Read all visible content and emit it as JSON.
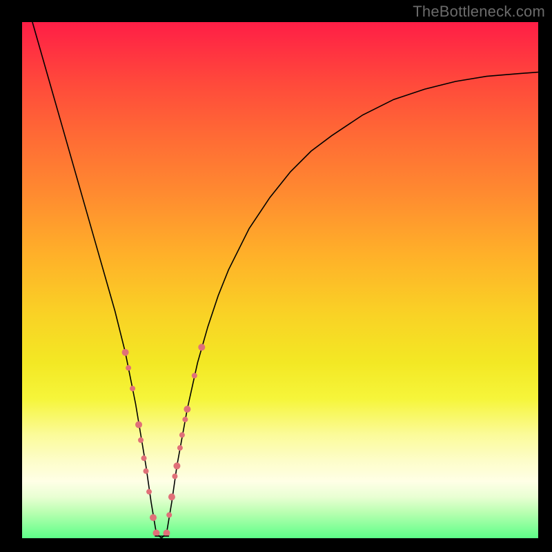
{
  "watermark": "TheBottleneck.com",
  "colors": {
    "gradient_top": "#ff1e46",
    "gradient_bottom": "#5dff88",
    "curve": "#000000",
    "dots": "#e07078",
    "frame": "#000000"
  },
  "chart_data": {
    "type": "line",
    "title": "",
    "xlabel": "",
    "ylabel": "",
    "xlim": [
      0,
      100
    ],
    "ylim": [
      0,
      100
    ],
    "legend": false,
    "grid": false,
    "series": [
      {
        "name": "bottleneck-curve",
        "x": [
          2,
          4,
          6,
          8,
          10,
          12,
          14,
          16,
          18,
          20,
          21,
          22,
          23,
          24,
          25,
          26,
          27,
          28,
          29,
          30,
          32,
          34,
          36,
          38,
          40,
          44,
          48,
          52,
          56,
          60,
          66,
          72,
          78,
          84,
          90,
          96,
          100
        ],
        "y": [
          100,
          93,
          86,
          79,
          72,
          65,
          58,
          51,
          44,
          36,
          31,
          26,
          20,
          14,
          7,
          1,
          0,
          1,
          7,
          14,
          25,
          34,
          41,
          47,
          52,
          60,
          66,
          71,
          75,
          78,
          82,
          85,
          87,
          88.5,
          89.5,
          90,
          90.3
        ]
      }
    ],
    "dots": {
      "name": "sample-points",
      "points": [
        {
          "x": 20.0,
          "y": 36
        },
        {
          "x": 20.6,
          "y": 33
        },
        {
          "x": 21.4,
          "y": 29
        },
        {
          "x": 22.6,
          "y": 22
        },
        {
          "x": 23.0,
          "y": 19
        },
        {
          "x": 23.6,
          "y": 15.5
        },
        {
          "x": 24.0,
          "y": 13
        },
        {
          "x": 24.6,
          "y": 9
        },
        {
          "x": 25.4,
          "y": 4
        },
        {
          "x": 26.0,
          "y": 1
        },
        {
          "x": 28.0,
          "y": 1
        },
        {
          "x": 28.5,
          "y": 4.5
        },
        {
          "x": 29.0,
          "y": 8
        },
        {
          "x": 29.6,
          "y": 12
        },
        {
          "x": 30.0,
          "y": 14
        },
        {
          "x": 30.6,
          "y": 17.5
        },
        {
          "x": 31.0,
          "y": 20
        },
        {
          "x": 31.6,
          "y": 23
        },
        {
          "x": 32.0,
          "y": 25
        },
        {
          "x": 33.4,
          "y": 31.5
        },
        {
          "x": 34.8,
          "y": 37
        }
      ],
      "sizes": [
        10,
        8,
        8,
        10,
        8,
        8,
        8,
        8,
        10,
        10,
        10,
        8,
        10,
        8,
        10,
        8,
        8,
        8,
        10,
        8,
        10
      ]
    },
    "bottom_cap": {
      "x1": 25.8,
      "y1": 0.4,
      "x2": 28.4,
      "y2": 0.4
    }
  }
}
